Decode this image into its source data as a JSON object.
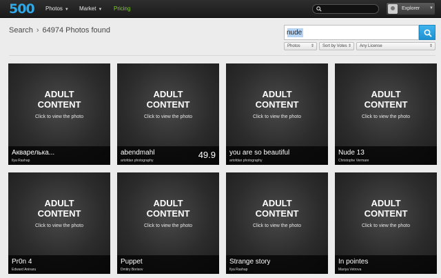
{
  "header": {
    "logo": "500",
    "nav": [
      {
        "label": "Photos",
        "has_caret": true
      },
      {
        "label": "Market",
        "has_caret": true
      },
      {
        "label": "Pricing",
        "has_caret": false
      }
    ],
    "top_search_placeholder": "",
    "user_name": "Explorer"
  },
  "breadcrumb": {
    "section": "Search",
    "result_text": "64974 Photos found"
  },
  "search": {
    "query": "nude",
    "filters": [
      "Photos",
      "Sort by Votes",
      "Any License"
    ]
  },
  "tile_overlay": {
    "heading_line1": "ADULT",
    "heading_line2": "CONTENT",
    "subtext": "Click to view the photo"
  },
  "photos": [
    {
      "title": "Акварелька...",
      "author": "Ilya Rashap",
      "score": ""
    },
    {
      "title": "abendmahl",
      "author": "artofdan photography",
      "score": "49.9"
    },
    {
      "title": "you are so beautiful",
      "author": "artofdan photography",
      "score": ""
    },
    {
      "title": "Nude 13",
      "author": "Christophe Vermare",
      "score": ""
    },
    {
      "title": "Pr0n 4",
      "author": "Edward Aninaru",
      "score": ""
    },
    {
      "title": "Puppet",
      "author": "Dmitry Borisov",
      "score": ""
    },
    {
      "title": "Strange story",
      "author": "Ilya Rashap",
      "score": ""
    },
    {
      "title": "In pointes",
      "author": "Mariya Vetrova",
      "score": ""
    }
  ],
  "colors": {
    "logo_blue": "#2ea8e6",
    "pricing_green": "#7ed321",
    "search_button_blue": "#1e92d1"
  }
}
